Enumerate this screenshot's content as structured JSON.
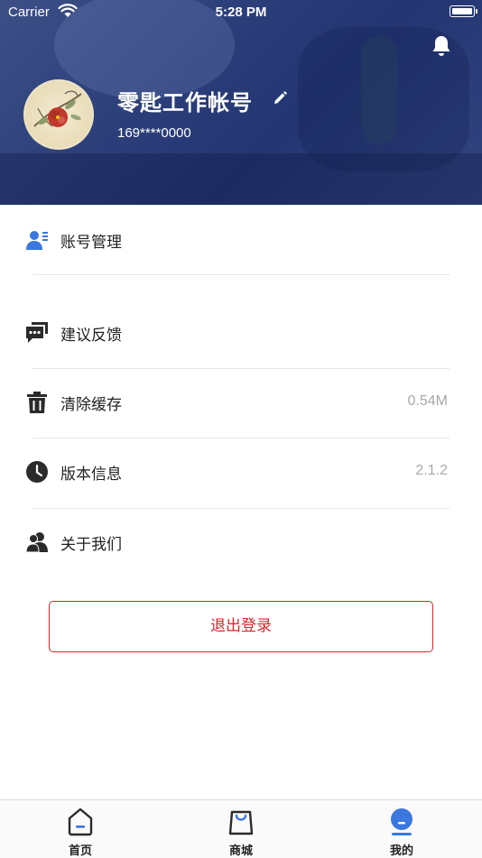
{
  "status_bar": {
    "carrier": "Carrier",
    "time": "5:28 PM"
  },
  "profile": {
    "name": "零匙工作帐号",
    "phone": "169****0000"
  },
  "menu": [
    {
      "label": "账号管理",
      "value": "",
      "icon": "account-manage-icon"
    },
    {
      "label": "建议反馈",
      "value": "",
      "icon": "feedback-icon"
    },
    {
      "label": "清除缓存",
      "value": "0.54M",
      "icon": "trash-icon"
    },
    {
      "label": "版本信息",
      "value": "2.1.2",
      "icon": "clock-icon"
    },
    {
      "label": "关于我们",
      "value": "",
      "icon": "about-us-icon"
    }
  ],
  "logout_label": "退出登录",
  "tabs": [
    {
      "label": "首页",
      "icon": "home-icon",
      "active": false
    },
    {
      "label": "商城",
      "icon": "shopping-bag-icon",
      "active": false
    },
    {
      "label": "我的",
      "icon": "profile-icon",
      "active": true
    }
  ],
  "colors": {
    "header": "#2d3f7a",
    "accent_blue": "#3a78e0",
    "logout_red": "#d8262c"
  }
}
